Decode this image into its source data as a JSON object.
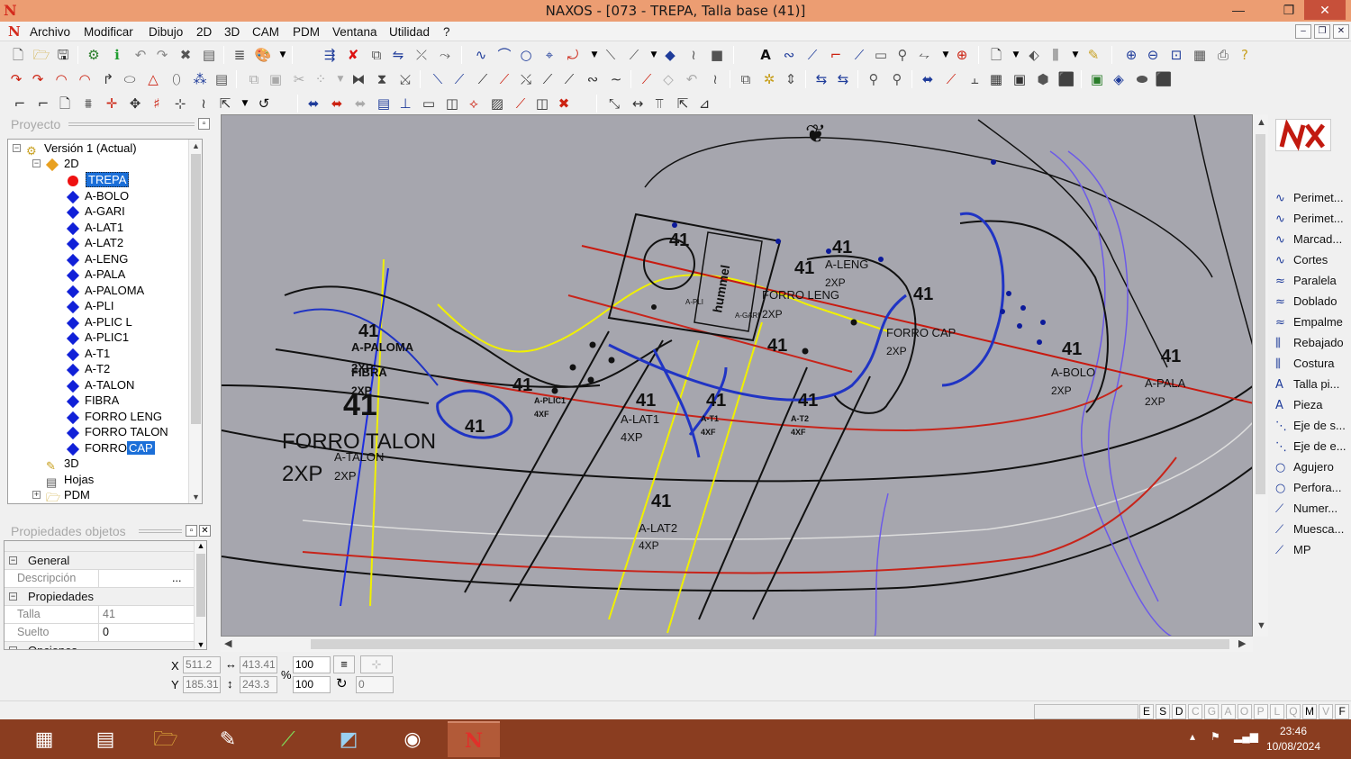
{
  "window": {
    "app_name": "NAXOS",
    "title": "NAXOS - [073 - TREPA, Talla base (41)]",
    "controls": {
      "minimize": "—",
      "maximize": "❐",
      "close": "✕"
    }
  },
  "menubar": {
    "items": [
      "Archivo",
      "Modificar",
      "Dibujo",
      "2D",
      "3D",
      "CAM",
      "PDM",
      "Ventana",
      "Utilidad",
      "?"
    ]
  },
  "project_panel": {
    "title": "Proyecto",
    "tree": {
      "root": "Versión 1 (Actual)",
      "folder_2d": "2D",
      "pieces": [
        "A-BOLO",
        "A-GARI",
        "A-LAT1",
        "A-LAT2",
        "A-LENG",
        "A-PALA",
        "A-PALOMA",
        "A-PLI",
        "A-PLIC L",
        "A-PLIC1",
        "A-T1",
        "A-T2",
        "A-TALON",
        "FIBRA",
        "FORRO LENG",
        "FORRO TALON"
      ],
      "selected": "TREPA",
      "last_piece_prefix": "FORRO",
      "last_piece_highlight": "CAP",
      "folder_3d": "3D",
      "sheets": "Hojas",
      "pdm": "PDM"
    }
  },
  "properties_panel": {
    "title": "Propiedades objetos",
    "general_label": "General",
    "descripcion_label": "Descripción",
    "descripcion_button": "...",
    "propiedades_label": "Propiedades",
    "talla_label": "Talla",
    "talla_value": "41",
    "suelto_label": "Suelto",
    "suelto_value": "0",
    "opciones_label": "Opciones"
  },
  "canvas": {
    "labels": {
      "size": "41",
      "a_paloma": "A-PALOMA",
      "fibra": "FIBRA",
      "fibra_qty": "2XP",
      "paloma_qty": "2XP",
      "forro_talon": "FORRO TALON",
      "forro_talon_qty": "2XP",
      "a_talon": "A-TALON",
      "a_talon_qty": "2XP",
      "a_plic1": "A-PLIC1",
      "a_plic_qty": "4XF",
      "a_lat1": "A-LAT1",
      "a_lat1_qty": "4XP",
      "a_t1": "A-T1",
      "a_t1_qty": "4XF",
      "a_t2": "A-T2",
      "a_t2_qty": "4XF",
      "a_lat2": "A-LAT2",
      "a_lat2_qty": "4XP",
      "a_leng": "A-LENG",
      "a_leng_qty": "2XP",
      "forro_leng": "FORRO LENG",
      "forro_leng_qty": "2XP",
      "forro_cap": "FORRO CAP",
      "forro_cap_qty": "2XP",
      "a_bolo": "A-BOLO",
      "a_bolo_qty": "2XP",
      "a_pala": "A-PALA",
      "a_pala_qty": "2XP",
      "a_gari": "A-GARI",
      "a_pli": "A-PLI",
      "brand_text": "hummel"
    }
  },
  "right_panel": {
    "logo_text": "NX",
    "tools": [
      {
        "icon": "perimeter-icon",
        "glyph": "∿",
        "label": "Perimet..."
      },
      {
        "icon": "perimeter-icon",
        "glyph": "∿",
        "label": "Perimet..."
      },
      {
        "icon": "mark-icon",
        "glyph": "∿",
        "label": "Marcad..."
      },
      {
        "icon": "cut-icon",
        "glyph": "∿",
        "label": "Cortes"
      },
      {
        "icon": "parallel-icon",
        "glyph": "≈",
        "label": "Paralela"
      },
      {
        "icon": "fold-icon",
        "glyph": "≈",
        "label": "Doblado"
      },
      {
        "icon": "join-icon",
        "glyph": "≈",
        "label": "Empalme"
      },
      {
        "icon": "skive-icon",
        "glyph": "⫼",
        "label": "Rebajado"
      },
      {
        "icon": "seam-icon",
        "glyph": "⫼",
        "label": "Costura"
      },
      {
        "icon": "size-text-icon",
        "glyph": "A",
        "label": "Talla pi..."
      },
      {
        "icon": "piece-text-icon",
        "glyph": "A",
        "label": "Pieza"
      },
      {
        "icon": "axis-icon",
        "glyph": "⋱",
        "label": "Eje de s..."
      },
      {
        "icon": "axis-icon",
        "glyph": "⋱",
        "label": "Eje de e..."
      },
      {
        "icon": "hole-icon",
        "glyph": "○",
        "label": "Agujero"
      },
      {
        "icon": "perforation-icon",
        "glyph": "○",
        "label": "Perfora..."
      },
      {
        "icon": "number-icon",
        "glyph": "⟋",
        "label": "Numer..."
      },
      {
        "icon": "notch-icon",
        "glyph": "⟋",
        "label": "Muesca..."
      },
      {
        "icon": "mp-icon",
        "glyph": "⟋",
        "label": "MP"
      }
    ]
  },
  "coords": {
    "x_label": "X",
    "y_label": "Y",
    "x_value": "511.2",
    "y_value": "185.31",
    "width_value": "413.41",
    "height_value": "243.3",
    "percent_label": "%",
    "scale_x": "100",
    "scale_y": "100",
    "rotation": "0"
  },
  "statusbar": {
    "letters": [
      "E",
      "S",
      "D",
      "C",
      "G",
      "A",
      "O",
      "P",
      "L",
      "Q",
      "M",
      "V",
      "F"
    ],
    "active_letters": [
      "E",
      "S",
      "D",
      "M",
      "F"
    ]
  },
  "taskbar": {
    "apps": [
      "calculator-icon",
      "explorer-icon",
      "folder-icon",
      "paint-icon",
      "cad-icon",
      "tool-icon",
      "chrome-icon",
      "naxos-icon"
    ],
    "time": "23:46",
    "date": "10/08/2024"
  }
}
